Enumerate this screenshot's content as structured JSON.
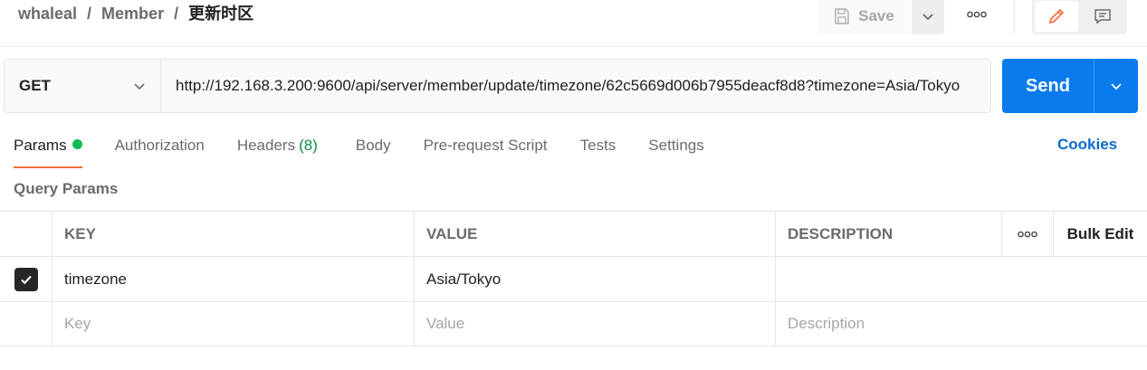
{
  "breadcrumb": {
    "workspace": "whaleal",
    "collection": "Member",
    "request": "更新时区"
  },
  "toolbar": {
    "save_label": "Save"
  },
  "request": {
    "method": "GET",
    "url": "http://192.168.3.200:9600/api/server/member/update/timezone/62c5669d006b7955deacf8d8?timezone=Asia/Tokyo",
    "send_label": "Send"
  },
  "tabs": [
    {
      "label": "Params"
    },
    {
      "label": "Authorization"
    },
    {
      "label": "Headers",
      "count": "(8)"
    },
    {
      "label": "Body"
    },
    {
      "label": "Pre-request Script"
    },
    {
      "label": "Tests"
    },
    {
      "label": "Settings"
    }
  ],
  "cookies_label": "Cookies",
  "query_params": {
    "title": "Query Params",
    "columns": {
      "key": "KEY",
      "value": "VALUE",
      "description": "DESCRIPTION",
      "bulk_edit": "Bulk Edit"
    },
    "rows": [
      {
        "key": "timezone",
        "value": "Asia/Tokyo",
        "description": "",
        "checked": true
      }
    ],
    "placeholders": {
      "key": "Key",
      "value": "Value",
      "description": "Description"
    }
  },
  "colors": {
    "accent_blue": "#097bed",
    "tab_underline": "#f26b3a",
    "status_green": "#0cbb52",
    "link_blue": "#0b6bcb"
  }
}
